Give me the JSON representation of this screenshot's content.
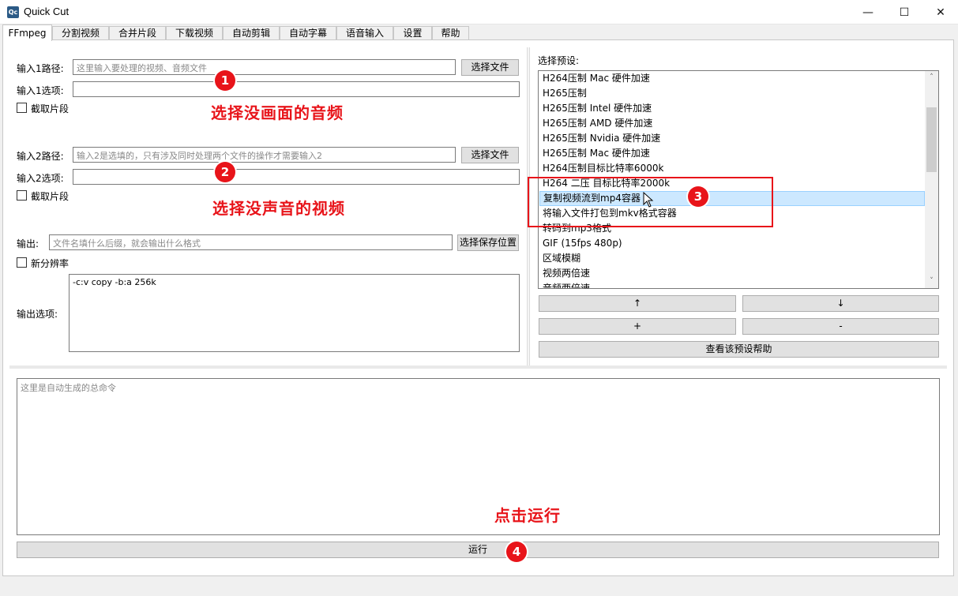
{
  "window": {
    "title": "Quick Cut",
    "icon_text": "Qc",
    "minimize": "—",
    "maximize": "☐",
    "close": "✕"
  },
  "tabs": [
    {
      "label": "FFmpeg"
    },
    {
      "label": "分割视频"
    },
    {
      "label": "合并片段"
    },
    {
      "label": "下载视频"
    },
    {
      "label": "自动剪辑"
    },
    {
      "label": "自动字幕"
    },
    {
      "label": "语音输入"
    },
    {
      "label": "设置"
    },
    {
      "label": "帮助"
    }
  ],
  "input1": {
    "path_label": "输入1路径:",
    "path_placeholder": "这里输入要处理的视频、音频文件",
    "choose_button": "选择文件",
    "options_label": "输入1选项:",
    "options_value": "",
    "clip_checkbox": "截取片段"
  },
  "input2": {
    "path_label": "输入2路径:",
    "path_placeholder": "输入2是选填的，只有涉及同时处理两个文件的操作才需要输入2",
    "choose_button": "选择文件",
    "options_label": "输入2选项:",
    "options_value": "",
    "clip_checkbox": "截取片段"
  },
  "output": {
    "label": "输出:",
    "placeholder": "文件名填什么后缀，就会输出什么格式",
    "choose_button": "选择保存位置",
    "resolution_checkbox": "新分辨率",
    "options_label": "输出选项:",
    "options_value": "-c:v copy -b:a 256k"
  },
  "presets": {
    "label": "选择预设:",
    "items": [
      "H264压制 Mac 硬件加速",
      "H265压制",
      "H265压制 Intel 硬件加速",
      "H265压制 AMD 硬件加速",
      "H265压制 Nvidia 硬件加速",
      "H265压制 Mac 硬件加速",
      "H264压制目标比特率6000k",
      "H264 二压 目标比特率2000k",
      "复制视频流到mp4容器",
      "将输入文件打包到mkv格式容器",
      "转码到mp3格式",
      "GIF (15fps 480p)",
      "区域模糊",
      "视频两倍速",
      "音频两倍速"
    ],
    "selected_index": 8,
    "scroll_up": "˄",
    "scroll_down": "˅",
    "move_up_button": "↑",
    "move_down_button": "↓",
    "add_button": "+",
    "remove_button": "-",
    "help_button": "查看该预设帮助"
  },
  "command": {
    "placeholder": "这里是自动生成的总命令"
  },
  "run_button": "运行",
  "annotations": {
    "step1": "选择没画面的音频",
    "step2": "选择没声音的视频",
    "step4": "点击运行",
    "badge1": "1",
    "badge2": "2",
    "badge3": "3",
    "badge4": "4"
  },
  "colors": {
    "annotation": "#e8141a",
    "selection": "#cce8ff"
  }
}
